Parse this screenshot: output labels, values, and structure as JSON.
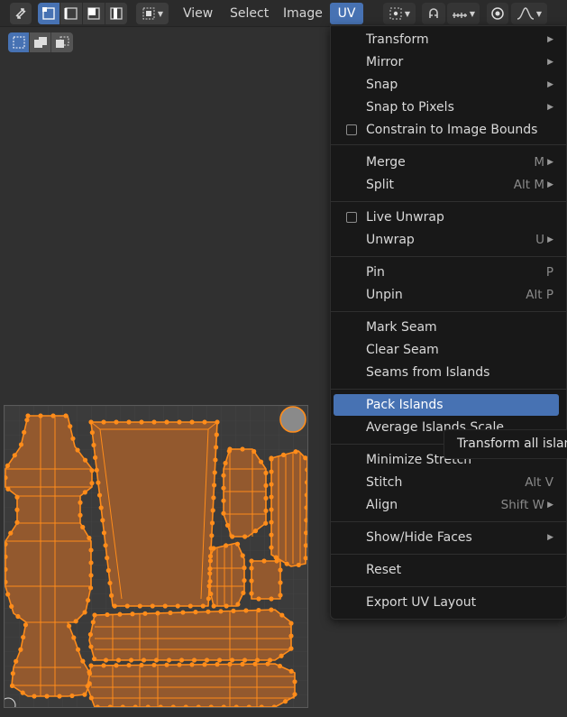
{
  "header": {
    "menus": {
      "view": "View",
      "select": "Select",
      "image": "Image",
      "uv": "UV"
    }
  },
  "uv_menu": {
    "items": [
      {
        "label": "Transform",
        "shortcut": "",
        "submenu": true
      },
      {
        "label": "Mirror",
        "shortcut": "",
        "submenu": true
      },
      {
        "label": "Snap",
        "shortcut": "",
        "submenu": true
      },
      {
        "label": "Snap to Pixels",
        "shortcut": "",
        "submenu": true
      },
      {
        "label": "Constrain to Image Bounds",
        "shortcut": "",
        "checkbox": true
      },
      {
        "label": "Merge",
        "shortcut": "M",
        "submenu": true
      },
      {
        "label": "Split",
        "shortcut": "Alt M",
        "submenu": true
      },
      {
        "label": "Live Unwrap",
        "shortcut": "",
        "checkbox": true
      },
      {
        "label": "Unwrap",
        "shortcut": "U",
        "submenu": true
      },
      {
        "label": "Pin",
        "shortcut": "P"
      },
      {
        "label": "Unpin",
        "shortcut": "Alt P"
      },
      {
        "label": "Mark Seam",
        "shortcut": ""
      },
      {
        "label": "Clear Seam",
        "shortcut": ""
      },
      {
        "label": "Seams from Islands",
        "shortcut": ""
      },
      {
        "label": "Pack Islands",
        "shortcut": "",
        "highlighted": true
      },
      {
        "label": "Average Islands Scale",
        "shortcut": ""
      },
      {
        "label": "Minimize Stretch",
        "shortcut": ""
      },
      {
        "label": "Stitch",
        "shortcut": "Alt V"
      },
      {
        "label": "Align",
        "shortcut": "Shift W",
        "submenu": true
      },
      {
        "label": "Show/Hide Faces",
        "shortcut": "",
        "submenu": true
      },
      {
        "label": "Reset",
        "shortcut": ""
      },
      {
        "label": "Export UV Layout",
        "shortcut": ""
      }
    ],
    "submenu_arrow": "▶"
  },
  "tooltip": {
    "text": "Transform all islands so that they fill up the UV/Image space as much as possible"
  },
  "icons": {
    "uv-sync-selection": "sync-arrows-icon",
    "select-vertex": "vertex-select-icon",
    "select-edge": "edge-select-icon",
    "select-face": "face-select-icon",
    "select-island": "island-select-icon",
    "sticky-selection": "sticky-select-icon",
    "pivot": "pivot-icon",
    "snap": "snap-magnet-icon",
    "snap-target": "snap-increment-icon",
    "proportional": "proportional-edit-icon",
    "falloff": "falloff-curve-icon"
  },
  "colors": {
    "accent": "#4772b3",
    "uv_face": "#93592e",
    "uv_edge": "#ff8c1a",
    "menu_bg": "#181818",
    "editor_bg": "#303030"
  }
}
